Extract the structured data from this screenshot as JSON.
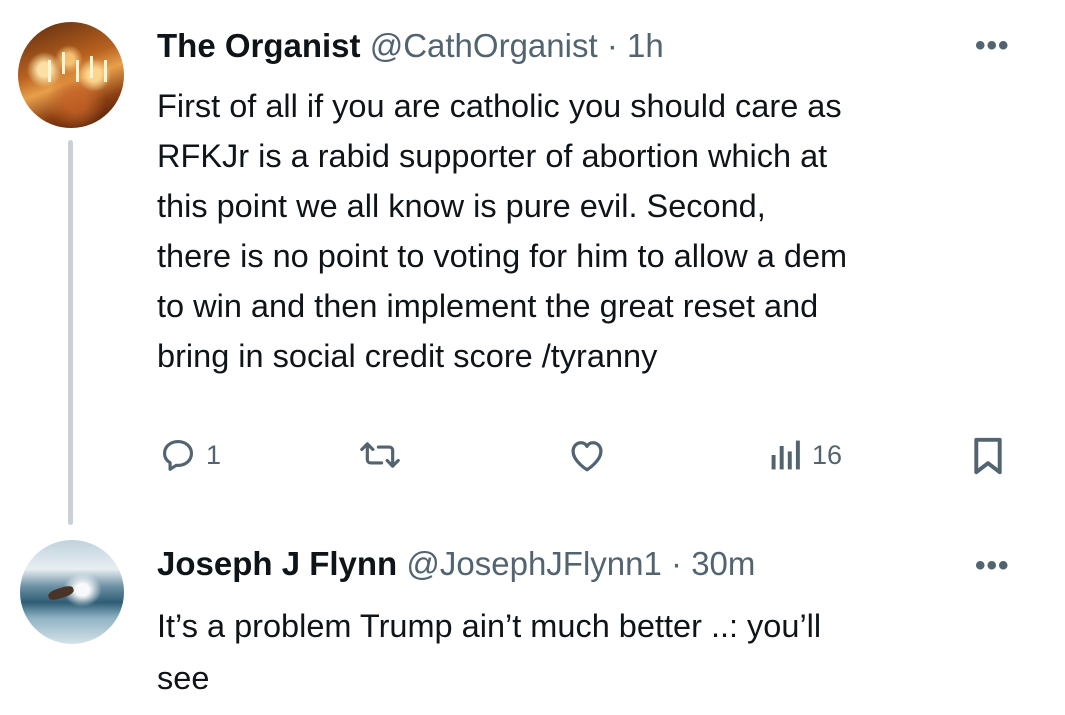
{
  "tweets": [
    {
      "author_name": "The Organist",
      "handle": "@CathOrganist",
      "separator": "·",
      "time": "1h",
      "more_label": "•••",
      "text_lines": [
        "First of all if you are catholic you should care as",
        "RFKJr is a rabid supporter of abortion which at",
        "this point we all know is pure evil.  Second,",
        "there is no point to voting for him to allow a dem",
        "to win and then implement the great reset and",
        "bring in social credit score /tyranny"
      ],
      "actions": {
        "reply_count": "1",
        "retweet_count": "",
        "like_count": "",
        "views_count": "16"
      },
      "icons": [
        "reply-icon",
        "retweet-icon",
        "like-icon",
        "views-icon",
        "bookmark-icon"
      ]
    },
    {
      "author_name": "Joseph J Flynn",
      "handle": "@JosephJFlynn1",
      "separator": "·",
      "time": "30m",
      "more_label": "•••",
      "text_lines": [
        "It’s a problem Trump ain’t much better ..: you’ll",
        "see"
      ]
    }
  ],
  "colors": {
    "text_primary": "#0f1419",
    "text_secondary": "#536471",
    "thread_line": "#c9d0d6"
  }
}
